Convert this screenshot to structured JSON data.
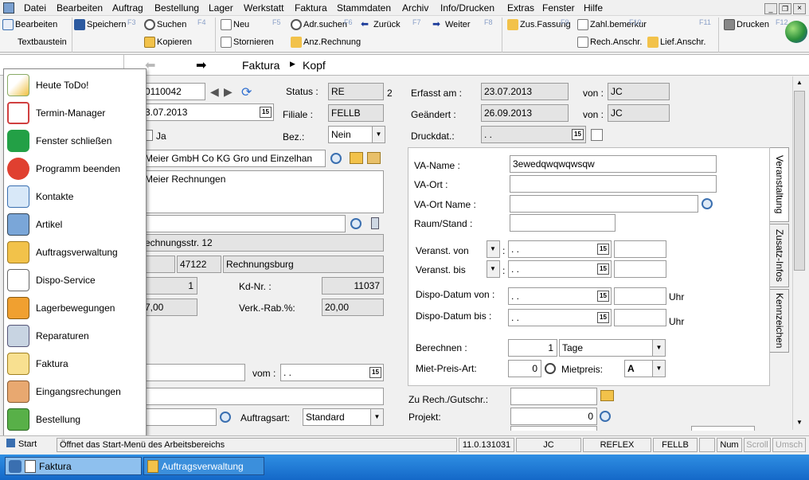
{
  "menu": {
    "items": [
      "Datei",
      "Bearbeiten",
      "Auftrag",
      "Bestellung",
      "Lager",
      "Werkstatt",
      "Faktura",
      "Stammdaten",
      "Archiv",
      "Info/Drucken",
      "Extras",
      "Fenster",
      "Hilfe"
    ]
  },
  "toolbar": {
    "bearbeiten": "Bearbeiten",
    "speichern": "Speichern",
    "suchen": "Suchen",
    "neu": "Neu",
    "adr_suchen": "Adr.suchen",
    "zurueck": "Zurück",
    "weiter": "Weiter",
    "zus_fassung": "Zus.Fassung",
    "zahl_bemerkung": "Zahl.bemerkur",
    "drucken": "Drucken",
    "textbaustein": "Textbaustein",
    "kopieren": "Kopieren",
    "stornieren": "Stornieren",
    "anz_rechnung": "Anz.Rechnung",
    "rech_anschr": "Rech.Anschr.",
    "lief_anschr": "Lief.Anschr.",
    "f3": "F3",
    "f4": "F4",
    "f5": "F5",
    "f6": "F6",
    "f7": "F7",
    "f8": "F8",
    "f9": "F9",
    "f10": "F10",
    "f11": "F11",
    "f12": "F12"
  },
  "nav": {
    "breadcrumb_1": "Faktura",
    "breadcrumb_2": "Kopf"
  },
  "form": {
    "beleg_nr": "0110042",
    "beleg_datum": "3.07.2013",
    "ja_label": "Ja",
    "firma": "Meier GmbH  Co KG Gro und Einzelhan",
    "rechnungsname": "Meier Rechnungen",
    "strasse": "echnungsstr. 12",
    "plz": "47122",
    "ort": "Rechnungsburg",
    "kd_count": "1",
    "kd_nr_label": "Kd-Nr. :",
    "kd_nr": "11037",
    "betrag": "7,00",
    "verk_rab_label": "Verk.-Rab.%:",
    "verk_rab": "20,00",
    "vom_label": "vom :",
    "vom_value": ". .",
    "auftragsart_label": "Auftragsart:",
    "auftragsart": "Standard",
    "status_label": "Status :",
    "status": "RE",
    "status_num": "2",
    "filiale_label": "Filiale :",
    "filiale": "FELLB",
    "bez_label": "Bez.:",
    "bez": "Nein",
    "erfasst_label": "Erfasst am :",
    "erfasst": "23.07.2013",
    "geaendert_label": "Geändert :",
    "geaendert": "26.09.2013",
    "von_label": "von :",
    "von1": "JC",
    "von2": "JC",
    "druckdat_label": "Druckdat.:",
    "druckdat": ". .",
    "zu_rech_label": "Zu Rech./Gutschr.:",
    "projekt_label": "Projekt:",
    "projekt": "0"
  },
  "va": {
    "name_label": "VA-Name :",
    "name": "3ewedqwqwqwsqw",
    "ort_label": "VA-Ort :",
    "ort_name_label": "VA-Ort Name :",
    "raum_label": "Raum/Stand :",
    "von_label": "Veranst. von",
    "von": ". .",
    "bis_label": "Veranst. bis",
    "bis": ". .",
    "dispo_von_label": "Dispo-Datum von :",
    "dispo_von": ". .",
    "dispo_bis_label": "Dispo-Datum bis :",
    "dispo_bis": ". .",
    "uhr": "Uhr",
    "berechnen_label": "Berechnen :",
    "berechnen": "1",
    "berechnen_unit": "Tage",
    "mietpreisart_label": "Miet-Preis-Art:",
    "mietpreisart": "0",
    "mietpreis_label": "Mietpreis:",
    "mietpreis": "A",
    "tabs": [
      "Veranstaltung",
      "Zusatz-Infos",
      "Kennzeichen"
    ]
  },
  "startmenu": {
    "items": [
      "Heute ToDo!",
      "Termin-Manager",
      "Fenster schließen",
      "Programm beenden",
      "Kontakte",
      "Artikel",
      "Auftragsverwaltung",
      "Dispo-Service",
      "Lagerbewegungen",
      "Reparaturen",
      "Faktura",
      "Eingangsrechungen",
      "Bestellung"
    ]
  },
  "status": {
    "start": "Start",
    "message": "Öffnet das Start-Menü des Arbeitsbereichs",
    "version": "11.0.131031",
    "user": "JC",
    "db": "REFLEX",
    "filiale": "FELLB",
    "num": "Num",
    "scroll": "Scroll",
    "umsch": "Umsch"
  },
  "taskbar": {
    "tasks": [
      "Faktura",
      "Auftragsverwaltung"
    ]
  }
}
